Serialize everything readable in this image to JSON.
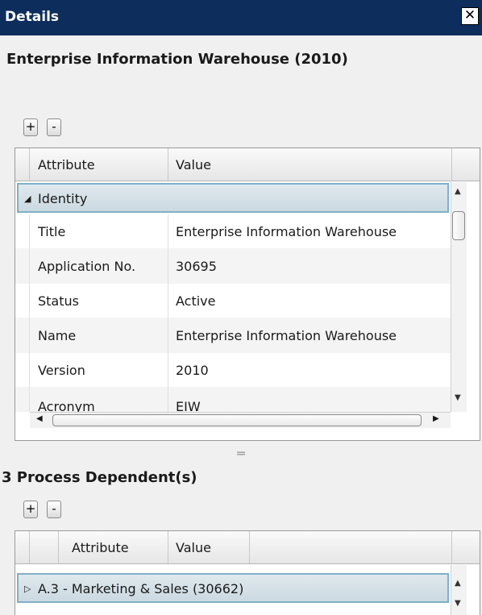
{
  "panel": {
    "title": "Details",
    "close_glyph": "✕"
  },
  "heading": "Enterprise Information Warehouse (2010)",
  "toolbar": {
    "add_label": "+",
    "remove_label": "-"
  },
  "grid": {
    "columns": [
      "Attribute",
      "Value"
    ],
    "group": {
      "expander": "◢",
      "label": "Identity"
    },
    "rows": [
      {
        "attribute": "Title",
        "value": "Enterprise Information Warehouse"
      },
      {
        "attribute": "Application No.",
        "value": "30695"
      },
      {
        "attribute": "Status",
        "value": "Active"
      },
      {
        "attribute": "Name",
        "value": "Enterprise Information Warehouse"
      },
      {
        "attribute": "Version",
        "value": "2010"
      },
      {
        "attribute": "Acronym",
        "value": "EIW"
      }
    ]
  },
  "dependents": {
    "heading": "3 Process Dependent(s)",
    "columns": [
      "Attribute",
      "Value"
    ],
    "group": {
      "expander": "▷",
      "label": "A.3 - Marketing & Sales (30662)"
    }
  },
  "icons": {
    "close": "close-icon",
    "scroll_up": "triangle-up-icon",
    "scroll_down": "triangle-down-icon",
    "scroll_left": "triangle-left-icon",
    "scroll_right": "triangle-right-icon"
  },
  "colors": {
    "titlebar": "#0d2e5c",
    "group_border": "#7fb0c8"
  }
}
